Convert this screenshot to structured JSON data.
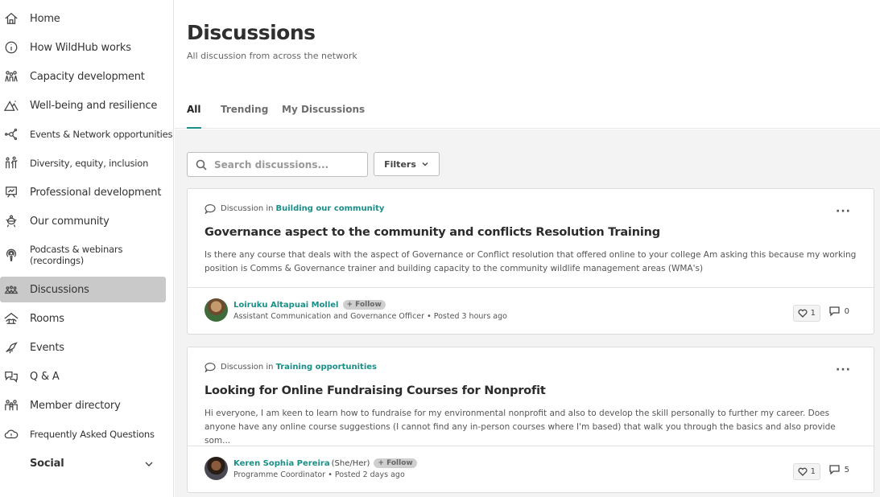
{
  "sidebar": {
    "items": [
      {
        "label": "Home",
        "icon": "home-icon"
      },
      {
        "label": "How WildHub works",
        "icon": "info-icon"
      },
      {
        "label": "Capacity development",
        "icon": "people-icon"
      },
      {
        "label": "Well-being and resilience",
        "icon": "mountain-icon"
      },
      {
        "label": "Events & Network opportunities",
        "icon": "network-icon"
      },
      {
        "label": "Diversity, equity, inclusion",
        "icon": "diversity-icon"
      },
      {
        "label": "Professional development",
        "icon": "presentation-icon"
      },
      {
        "label": "Our community",
        "icon": "community-icon"
      },
      {
        "label": "Podcasts & webinars (recordings)",
        "icon": "podcast-icon"
      },
      {
        "label": "Discussions",
        "icon": "discussions-icon"
      },
      {
        "label": "Rooms",
        "icon": "rooms-icon"
      },
      {
        "label": "Events",
        "icon": "bird-icon"
      },
      {
        "label": "Q & A",
        "icon": "qa-icon"
      },
      {
        "label": "Member directory",
        "icon": "members-icon"
      },
      {
        "label": "Frequently Asked Questions",
        "icon": "cloud-icon"
      }
    ],
    "social_label": "Social"
  },
  "header": {
    "title": "Discussions",
    "subtitle": "All discussion from across the network",
    "tabs": [
      "All",
      "Trending",
      "My Discussions"
    ]
  },
  "toolbar": {
    "search_placeholder": "Search discussions...",
    "filters_label": "Filters"
  },
  "posts": [
    {
      "meta_prefix": "Discussion in",
      "group": "Building our community",
      "title": "Governance aspect to the community and conflicts Resolution Training",
      "excerpt": "Is there any course that deals with the aspect of Governance or Conflict resolution that offered online to your college Am asking this because my working position is Comms & Governance trainer and building capacity to the community wildlife management areas (WMA's)",
      "author": "Loiruku Altapuai Mollel",
      "pronouns": "",
      "follow_label": "+ Follow",
      "role": "Assistant Communication and Governance Officer",
      "posted": "Posted 3 hours ago",
      "likes": "1",
      "comments": "0"
    },
    {
      "meta_prefix": "Discussion in",
      "group": "Training opportunities",
      "title": "Looking for Online Fundraising Courses for Nonprofit",
      "excerpt": "Hi everyone, I am keen to learn how to fundraise for my environmental nonprofit and also to develop the skill personally to further my career. Does anyone have any online course suggestions (I cannot find any in-person courses where I'm based) that walk you through the basics and also provide som...",
      "author": "Keren Sophia Pereira",
      "pronouns": "(She/Her)",
      "follow_label": "+ Follow",
      "role": "Programme Coordinator",
      "posted": "Posted 2 days ago",
      "likes": "1",
      "comments": "5"
    }
  ]
}
